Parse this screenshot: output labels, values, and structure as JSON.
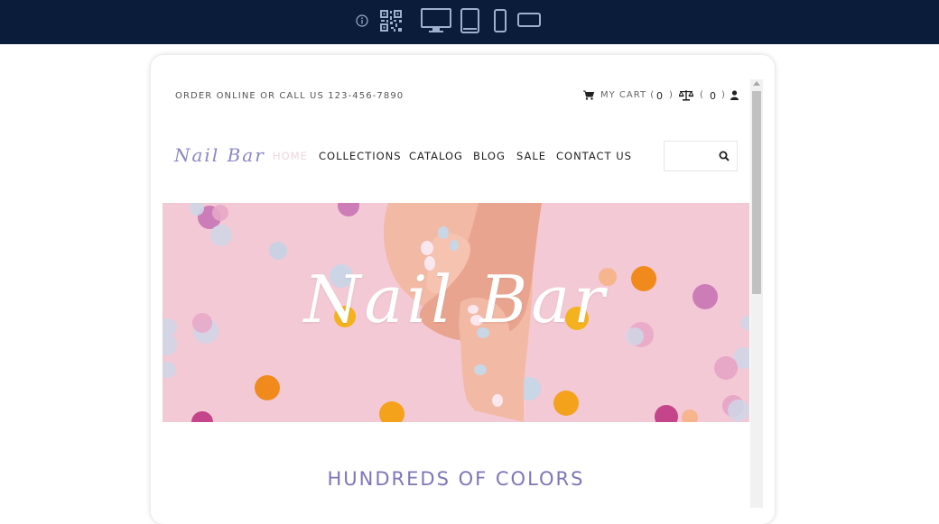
{
  "toolbar": {
    "icons": [
      "info-icon",
      "qr-code-icon",
      "desktop-icon",
      "tablet-icon",
      "phone-icon",
      "phone-landscape-icon"
    ],
    "background": "#0b1b3a",
    "icon_color": "#9fb0cf"
  },
  "header": {
    "order_text": "ORDER ONLINE OR CALL US 123-456-7890",
    "cart_label": "MY CART (",
    "cart_count": "0",
    "cart_close": ")",
    "compare_open": "(",
    "compare_count": "0",
    "compare_close": ")"
  },
  "logo": {
    "text": "Nail Bar",
    "color": "#8a86c8"
  },
  "nav": {
    "items": [
      {
        "label": "HOME",
        "active": true
      },
      {
        "label": "COLLECTIONS"
      },
      {
        "label": "CATALOG"
      },
      {
        "label": "BLOG"
      },
      {
        "label": "SALE"
      },
      {
        "label": "CONTACT US"
      }
    ],
    "active_color": "#f1d4de"
  },
  "search": {
    "icon": "search-icon"
  },
  "hero": {
    "title": "Nail Bar",
    "background": "#f3c9d5"
  },
  "section": {
    "heading": "HUNDREDS OF COLORS",
    "color": "#7d77b9"
  }
}
